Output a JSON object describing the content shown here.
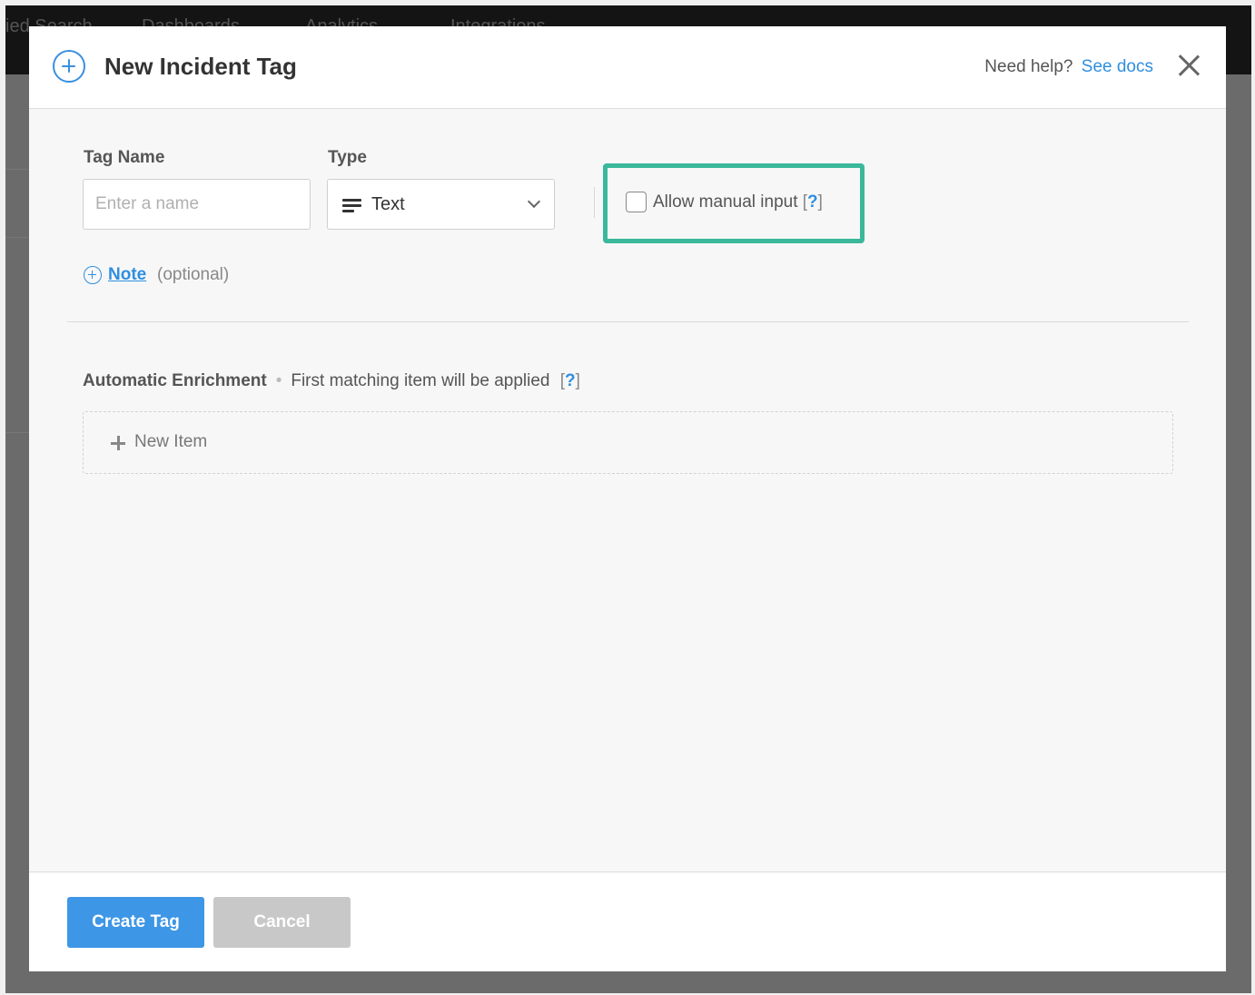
{
  "background": {
    "nav_items": [
      "ied Search",
      "Dashboards",
      "Analytics",
      "Integrations"
    ]
  },
  "modal": {
    "title": "New Incident Tag",
    "help_text": "Need help?",
    "help_link": "See docs",
    "close_icon": "close-icon",
    "accent_color": "#3a8fe0",
    "highlight_color": "#3bb89b"
  },
  "form": {
    "tag_name": {
      "label": "Tag Name",
      "placeholder": "Enter a name",
      "value": ""
    },
    "type": {
      "label": "Type",
      "selected": "Text",
      "icon": "text-lines-icon"
    },
    "manual_input": {
      "label": "Allow manual input",
      "help_open": "[",
      "help_mark": "?",
      "help_close": "]",
      "checked": false
    },
    "note": {
      "link": "Note",
      "optional": "(optional)"
    }
  },
  "enrichment": {
    "title": "Automatic Enrichment",
    "separator": "•",
    "subtitle": "First matching item will be applied",
    "help_open": "[",
    "help_mark": "?",
    "help_close": "]",
    "new_item_label": "New Item"
  },
  "footer": {
    "primary_label": "Create Tag",
    "secondary_label": "Cancel"
  }
}
